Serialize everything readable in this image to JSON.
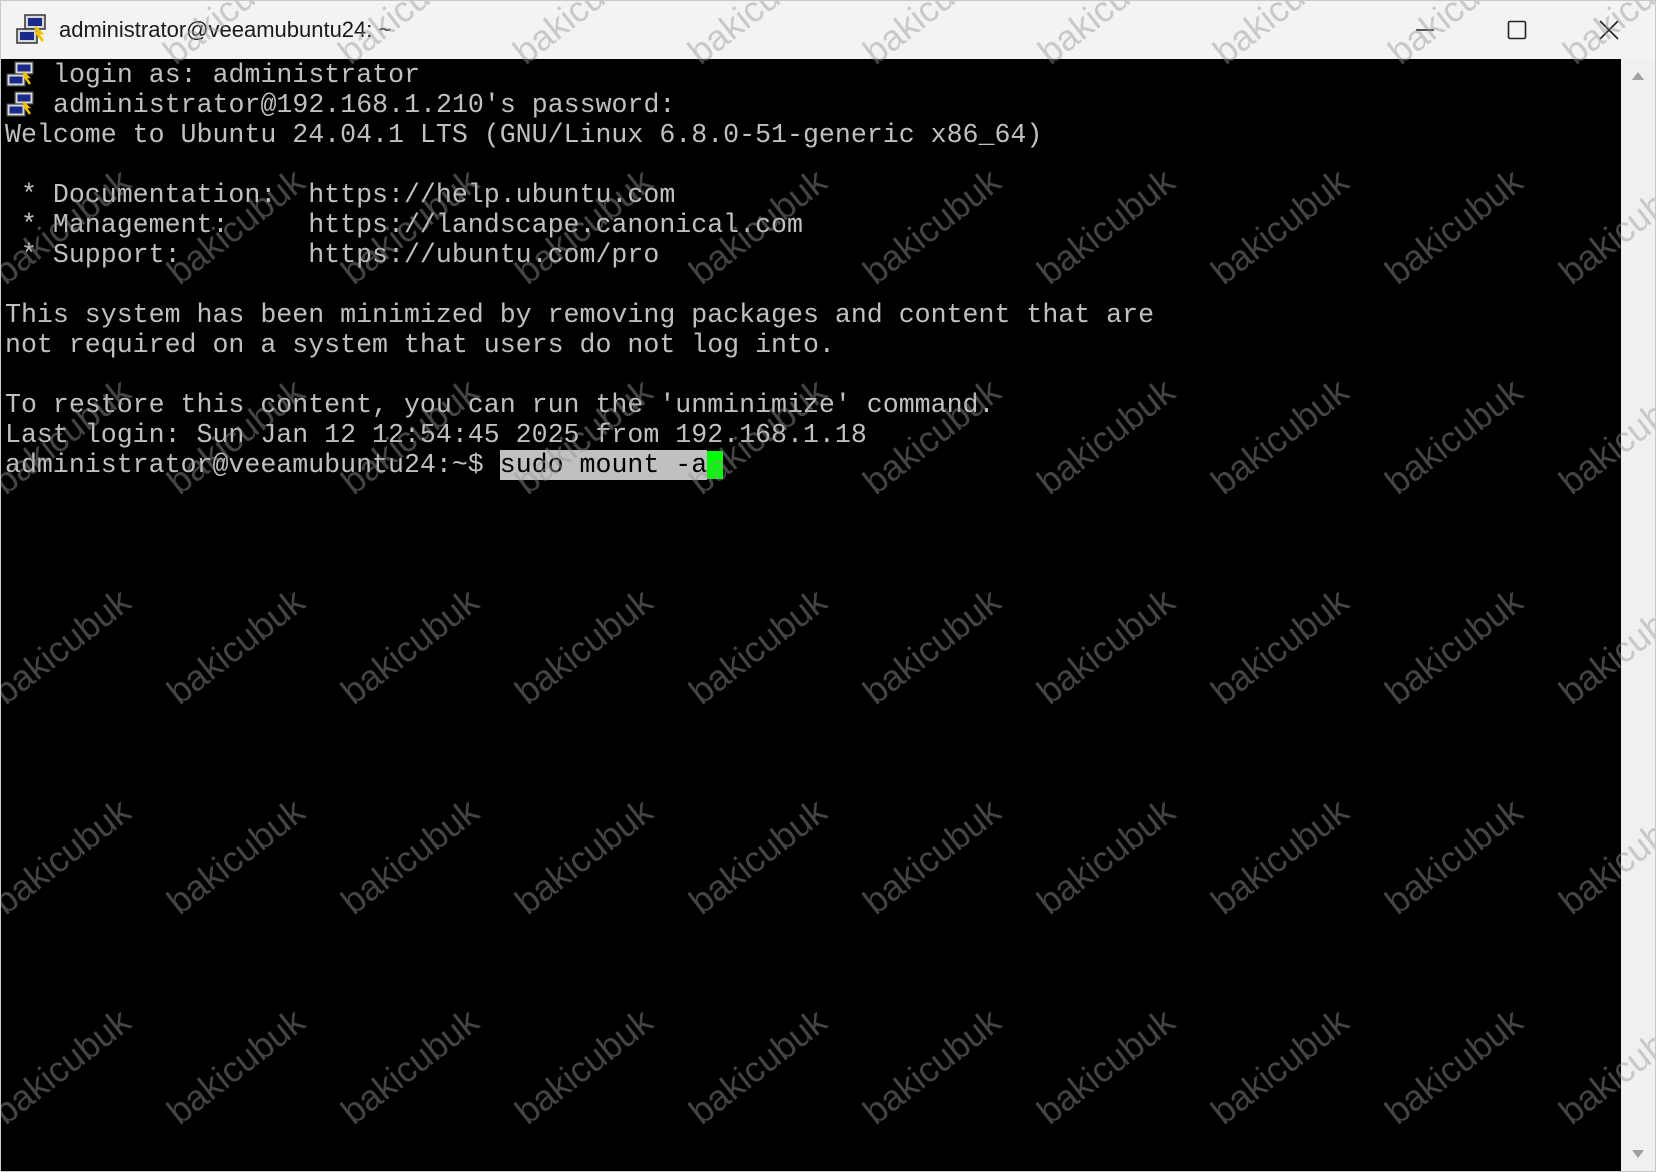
{
  "window": {
    "title": "administrator@veeamubuntu24: ~",
    "icon": "putty-icon",
    "controls": {
      "minimize": "minimize-icon",
      "maximize": "maximize-icon",
      "close": "close-icon"
    }
  },
  "terminal": {
    "lines": [
      {
        "icon": true,
        "text": "login as: administrator"
      },
      {
        "icon": true,
        "text": "administrator@192.168.1.210's password:"
      },
      {
        "icon": false,
        "text": "Welcome to Ubuntu 24.04.1 LTS (GNU/Linux 6.8.0-51-generic x86_64)"
      },
      {
        "icon": false,
        "text": ""
      },
      {
        "icon": false,
        "text": " * Documentation:  https://help.ubuntu.com"
      },
      {
        "icon": false,
        "text": " * Management:     https://landscape.canonical.com"
      },
      {
        "icon": false,
        "text": " * Support:        https://ubuntu.com/pro"
      },
      {
        "icon": false,
        "text": ""
      },
      {
        "icon": false,
        "text": "This system has been minimized by removing packages and content that are"
      },
      {
        "icon": false,
        "text": "not required on a system that users do not log into."
      },
      {
        "icon": false,
        "text": ""
      },
      {
        "icon": false,
        "text": "To restore this content, you can run the 'unminimize' command."
      },
      {
        "icon": false,
        "text": "Last login: Sun Jan 12 12:54:45 2025 from 192.168.1.18"
      }
    ],
    "prompt": "administrator@veeamubuntu24:~$ ",
    "command": "sudo mount -a"
  },
  "watermark": {
    "text": "bakicubuk"
  },
  "colors": {
    "terminal_bg": "#000000",
    "terminal_fg": "#c0c0c0",
    "cursor": "#00ff00",
    "titlebar_bg": "#f3f3f3"
  }
}
